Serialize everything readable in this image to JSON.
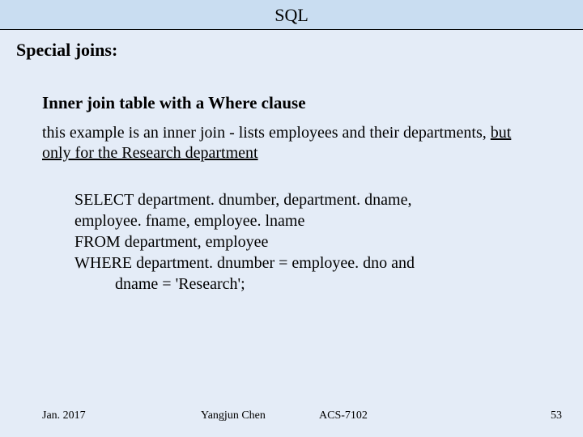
{
  "title": "SQL",
  "section_heading": "Special joins:",
  "subheading": "Inner join table with a Where clause",
  "desc_pre": "this example is an inner join - lists employees and their departments, ",
  "desc_underlined": "but only for the Research department",
  "sql": {
    "l1": "SELECT department. dnumber, department. dname,",
    "l2": "employee. fname, employee. lname",
    "l3": "FROM department, employee",
    "l4": "WHERE department. dnumber = employee. dno and",
    "l5": "          dname = 'Research';"
  },
  "footer": {
    "date": "Jan. 2017",
    "author": "Yangjun Chen",
    "course": "ACS-7102",
    "page": "53"
  }
}
